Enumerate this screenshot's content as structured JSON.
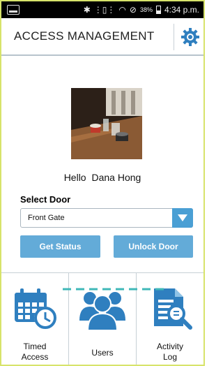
{
  "status_bar": {
    "battery_percent": "38%",
    "time": "4:34 p.m.",
    "icons": [
      "notification-icon",
      "bluetooth-icon",
      "vibrate-icon",
      "wifi-icon",
      "block-icon",
      "battery-icon"
    ]
  },
  "header": {
    "title": "ACCESS MANAGEMENT",
    "settings_icon": "gear-icon"
  },
  "profile": {
    "greeting": "Hello",
    "name": "Dana Hong"
  },
  "door": {
    "label": "Select Door",
    "selected": "Front Gate"
  },
  "actions": {
    "get_status": "Get Status",
    "unlock_door": "Unlock Door"
  },
  "nav": {
    "items": [
      {
        "label_line1": "Timed",
        "label_line2": "Access",
        "icon": "calendar-clock-icon"
      },
      {
        "label": "Users",
        "icon": "users-icon"
      },
      {
        "label_line1": "Activity",
        "label_line2": "Log",
        "icon": "document-search-icon"
      }
    ]
  },
  "colors": {
    "accent": "#4a9fd4",
    "button": "#63abd8",
    "icon_blue": "#2f7fbf",
    "connector": "#3fb8b8",
    "frame": "#d7e36a"
  }
}
